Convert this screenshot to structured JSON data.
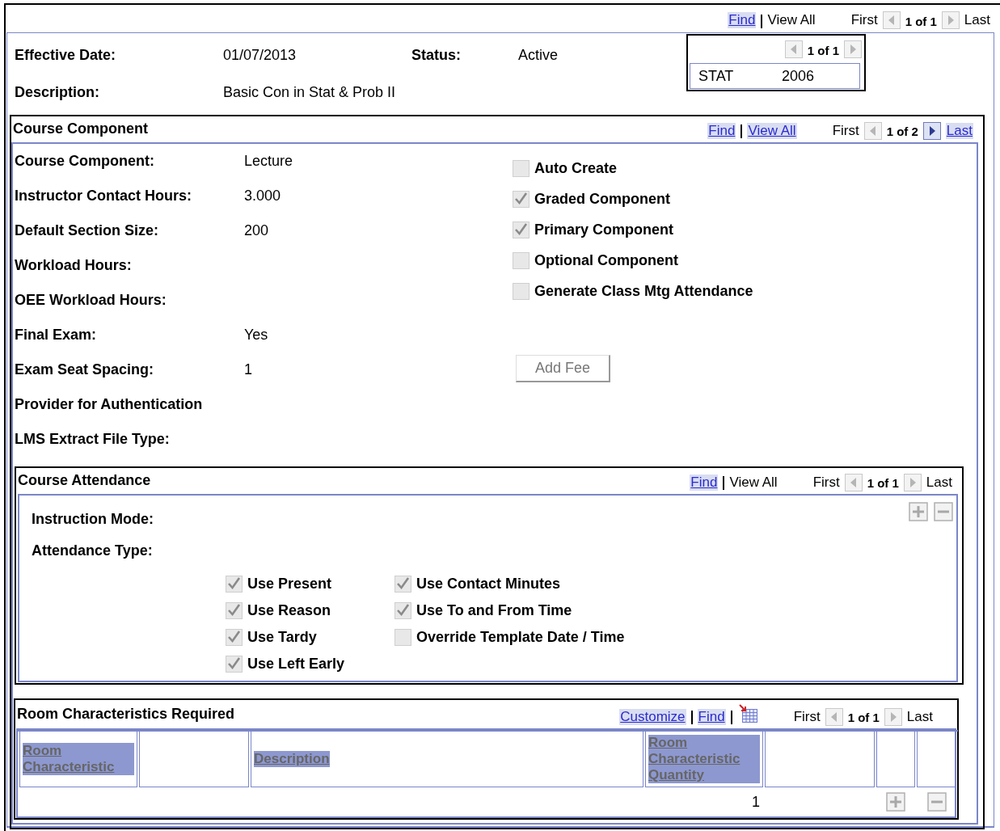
{
  "top_pager": {
    "items": [
      {
        "kind": "link",
        "label": "Find"
      },
      {
        "kind": "text",
        "label": "View All"
      }
    ],
    "first": {
      "label": "First",
      "link": false
    },
    "prev_enabled": false,
    "position": "1 of 1",
    "next_enabled": false,
    "last": {
      "label": "Last",
      "link": false
    }
  },
  "header": {
    "effective_date_label": "Effective Date:",
    "effective_date": "01/07/2013",
    "status_label": "Status:",
    "status": "Active",
    "description_label": "Description:",
    "description": "Basic Con in Stat & Prob II"
  },
  "subject_box": {
    "pager": {
      "prev_enabled": false,
      "position": "1 of 1",
      "next_enabled": false
    },
    "subject": "STAT",
    "catalog_number": "2006"
  },
  "course_component": {
    "title": "Course Component",
    "pager": {
      "items": [
        {
          "kind": "link",
          "label": "Find"
        },
        {
          "kind": "link",
          "label": "View All"
        }
      ],
      "first": {
        "label": "First",
        "link": false
      },
      "prev_enabled": false,
      "position": "1 of 2",
      "next_enabled": true,
      "last": {
        "label": "Last",
        "link": true
      }
    },
    "fields": [
      {
        "label": "Course Component:",
        "value": "Lecture"
      },
      {
        "label": "Instructor Contact Hours:",
        "value": "3.000"
      },
      {
        "label": "Default Section Size:",
        "value": "200"
      },
      {
        "label": "Workload Hours:"
      },
      {
        "label": "OEE Workload Hours:"
      },
      {
        "label": "Final Exam:",
        "value": "Yes"
      },
      {
        "label": "Exam Seat Spacing:",
        "value": "1"
      },
      {
        "label": "Provider for Authentication"
      },
      {
        "label": "LMS Extract File Type:"
      }
    ],
    "options": [
      {
        "label": "Auto Create",
        "checked": false
      },
      {
        "label": "Graded Component",
        "checked": true
      },
      {
        "label": "Primary Component",
        "checked": true
      },
      {
        "label": "Optional Component",
        "checked": false
      },
      {
        "label": "Generate Class Mtg Attendance",
        "checked": false
      }
    ],
    "add_fee_button": "Add Fee",
    "course_attendance": {
      "title": "Course Attendance",
      "pager": {
        "items": [
          {
            "kind": "link",
            "label": "Find"
          },
          {
            "kind": "text",
            "label": "View All"
          }
        ],
        "first": {
          "label": "First",
          "link": false
        },
        "prev_enabled": false,
        "position": "1 of 1",
        "next_enabled": false,
        "last": {
          "label": "Last",
          "link": false
        }
      },
      "fields": [
        {
          "label": "Instruction Mode:"
        },
        {
          "label": "Attendance Type:"
        }
      ],
      "option_columns": [
        {
          "items": [
            {
              "label": "Use Present",
              "checked": true
            },
            {
              "label": "Use Reason",
              "checked": true
            },
            {
              "label": "Use Tardy",
              "checked": true
            },
            {
              "label": "Use Left Early",
              "checked": true
            }
          ]
        },
        {
          "items": [
            {
              "label": "Use Contact Minutes",
              "checked": true
            },
            {
              "label": "Use To and From Time",
              "checked": true
            },
            {
              "label": "Override Template Date / Time",
              "checked": false
            }
          ]
        }
      ]
    },
    "room_characteristics": {
      "title": "Room Characteristics Required",
      "pager": {
        "items": [
          {
            "kind": "link",
            "label": "Customize"
          },
          {
            "kind": "link",
            "label": "Find"
          },
          {
            "kind": "grid"
          }
        ],
        "first": {
          "label": "First",
          "link": false
        },
        "prev_enabled": false,
        "position": "1 of 1",
        "next_enabled": false,
        "last": {
          "label": "Last",
          "link": false
        }
      },
      "columns": [
        {
          "kind": "sortable",
          "label": "Room Characteristic"
        },
        {
          "kind": "blank"
        },
        {
          "kind": "sortable",
          "label": "Description"
        },
        {
          "kind": "sortable",
          "label": "Room Characteristic Quantity"
        },
        {
          "kind": "blank"
        },
        {
          "kind": "blank"
        },
        {
          "kind": "blank"
        }
      ],
      "rows": [
        {
          "quantity": "1"
        }
      ]
    }
  }
}
